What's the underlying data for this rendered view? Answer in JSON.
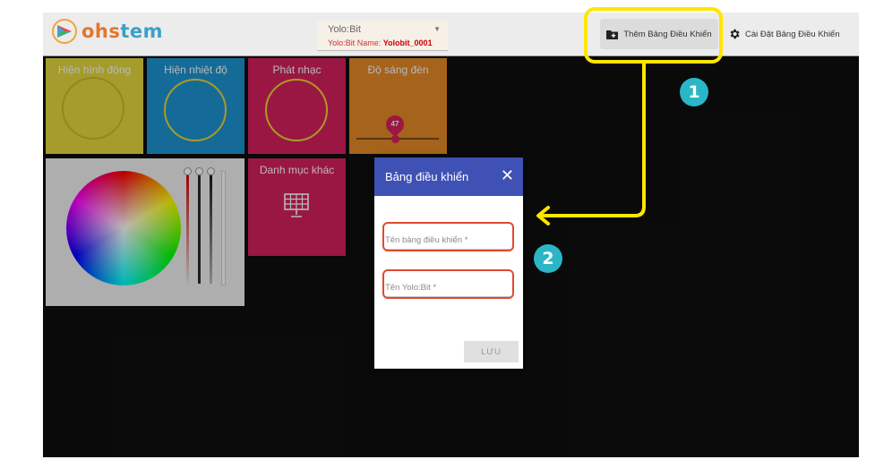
{
  "brand": {
    "logo_part1": "ohs",
    "logo_part2": "tem"
  },
  "device_selector": {
    "name": "Yolo:Bit",
    "sub_label": "Yolo:Bit Name:",
    "sub_value": "Yolobit_0001"
  },
  "toolbar": {
    "add_dashboard_label": "Thêm Bảng Điều Khiển",
    "settings_label": "Cài Đặt Bảng Điều Khiển"
  },
  "tiles": [
    {
      "title": "Hiện hình động",
      "color": "#e5d83f"
    },
    {
      "title": "Hiện nhiệt độ",
      "color": "#1e95d3"
    },
    {
      "title": "Phát nhạc",
      "color": "#d6215e"
    },
    {
      "title": "Độ sáng đèn",
      "color": "#e58a27",
      "slider_value": "47"
    },
    {
      "title": "Danh mục khác",
      "color": "#d6215e"
    }
  ],
  "dialog": {
    "title": "Bảng điều khiển",
    "close_symbol": "✕",
    "dashboard_name_placeholder": "Tên bảng điều khiển *",
    "device_name_placeholder": "Tên Yolo:Bit *",
    "save_label": "LƯU"
  },
  "annotations": {
    "step1": "1",
    "step2": "2",
    "highlight_color": "#ffe600",
    "field_highlight_color": "#e04a2e",
    "badge_color": "#2bb6c7"
  },
  "icons": [
    "folder-plus-icon",
    "gear-icon",
    "dropdown-caret-icon",
    "close-icon",
    "solar-panel-icon",
    "color-wheel"
  ]
}
